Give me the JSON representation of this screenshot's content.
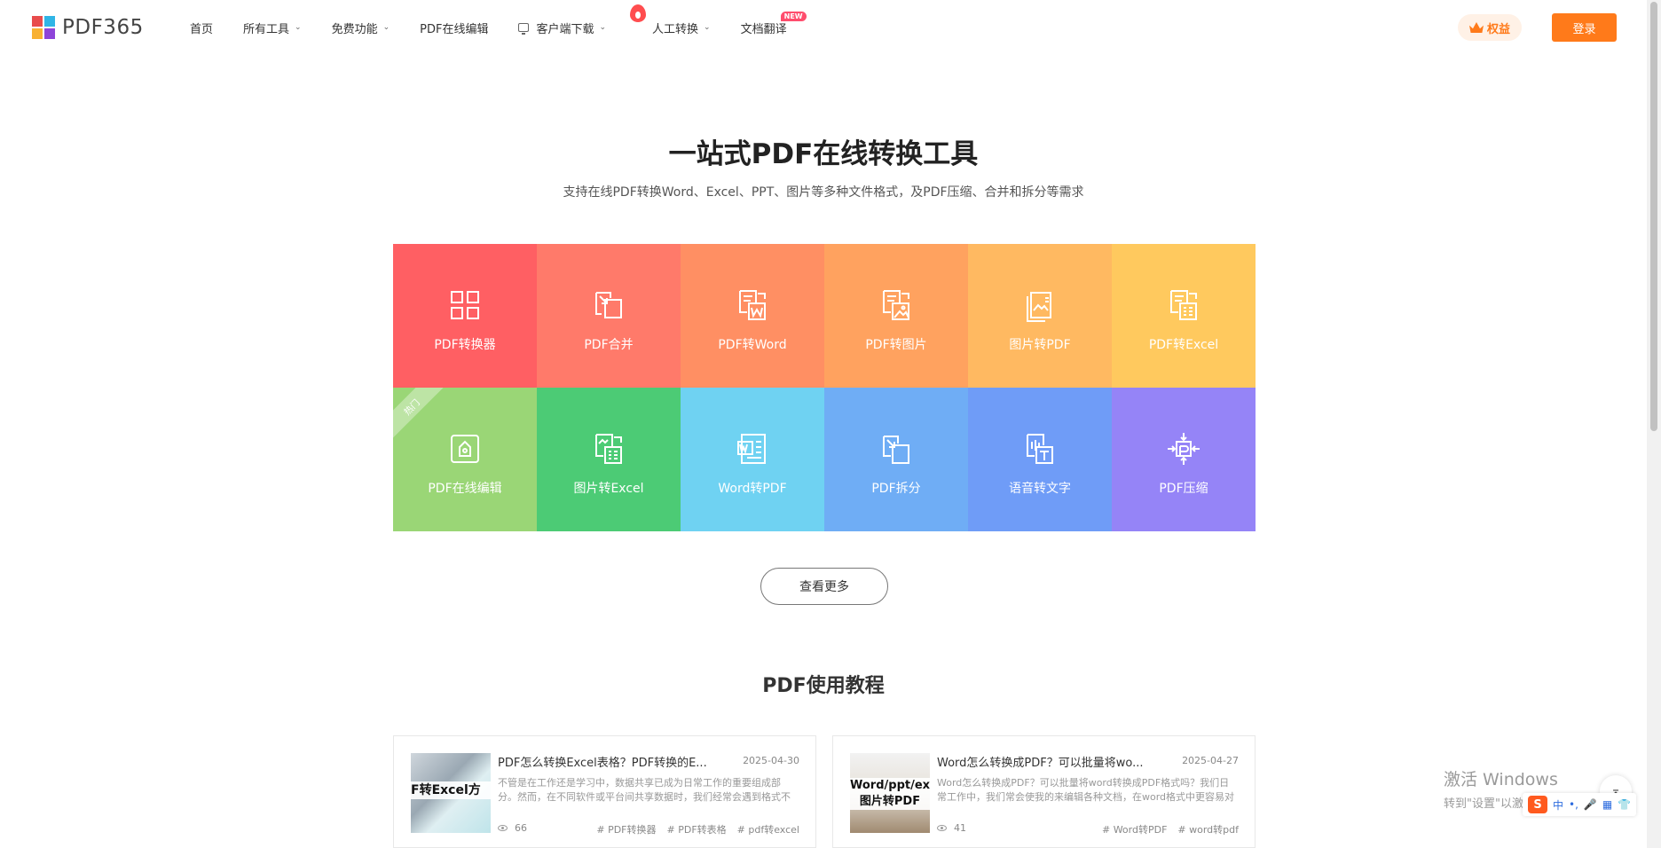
{
  "header": {
    "logo_text": "PDF365",
    "logo_colors": [
      "#e84c4c",
      "#2fb5e6",
      "#f8b133",
      "#8e44d9"
    ],
    "nav": [
      {
        "label": "首页",
        "caret": false
      },
      {
        "label": "所有工具",
        "caret": true
      },
      {
        "label": "免费功能",
        "caret": true
      },
      {
        "label": "PDF在线编辑",
        "caret": false
      },
      {
        "label": "客户端下载",
        "caret": true
      },
      {
        "label": "人工转换",
        "caret": true
      },
      {
        "label": "文档翻译",
        "caret": false
      }
    ],
    "new_badge": "NEW",
    "vip_label": "权益",
    "login_label": "登录"
  },
  "hero": {
    "title": "一站式PDF在线转换工具",
    "subtitle": "支持在线PDF转换Word、Excel、PPT、图片等多种文件格式，及PDF压缩、合并和拆分等需求"
  },
  "tools": [
    {
      "label": "PDF转换器",
      "color": "#ff5f63",
      "icon": "grid-icon"
    },
    {
      "label": "PDF合并",
      "color": "#ff7a6a",
      "icon": "merge-icon"
    },
    {
      "label": "PDF转Word",
      "color": "#ff8f63",
      "icon": "pdf-to-word-icon"
    },
    {
      "label": "PDF转图片",
      "color": "#ffa25f",
      "icon": "pdf-to-image-icon"
    },
    {
      "label": "图片转PDF",
      "color": "#ffb961",
      "icon": "image-to-pdf-icon"
    },
    {
      "label": "PDF转Excel",
      "color": "#ffc95e",
      "icon": "pdf-to-excel-icon"
    },
    {
      "label": "PDF在线编辑",
      "color": "#9ad676",
      "icon": "edit-icon",
      "ribbon": "热门"
    },
    {
      "label": "图片转Excel",
      "color": "#4ccb75",
      "icon": "image-to-excel-icon"
    },
    {
      "label": "Word转PDF",
      "color": "#6fd2f2",
      "icon": "word-to-pdf-icon"
    },
    {
      "label": "PDF拆分",
      "color": "#6fadf5",
      "icon": "split-icon"
    },
    {
      "label": "语音转文字",
      "color": "#6f9cf7",
      "icon": "voice-to-text-icon"
    },
    {
      "label": "PDF压缩",
      "color": "#9584f7",
      "icon": "compress-icon"
    }
  ],
  "more_label": "查看更多",
  "tutorial_title": "PDF使用教程",
  "articles": [
    {
      "thumb_text": "F转Excel方",
      "title": "PDF怎么转换Excel表格？PDF转换的E...",
      "date": "2025-04-30",
      "desc": "不管是在工作还是学习中，数据共享已成为日常工作的重要组成部分。然而，在不同软件或平台间共享数据时，我们经常会遇到格式不兼容...",
      "views": "66",
      "tags": [
        "# PDF转换器",
        "# PDF转表格",
        "# pdf转excel"
      ]
    },
    {
      "thumb_text": "Word/ppt/ex 图片转PDF",
      "title": "Word怎么转换成PDF？可以批量将wo...",
      "date": "2025-04-27",
      "desc": "Word怎么转换成PDF？可以批量将word转换成PDF格式吗？我们日常工作中，我们常会使我的来编辑各种文档，在word格式中更容易对文...",
      "views": "41",
      "tags": [
        "# Word转PDF",
        "# word转pdf"
      ]
    }
  ],
  "windows": {
    "line1": "激活 Windows",
    "line2": "转到\"设置\"以激活 Windows。"
  },
  "ime": {
    "logo": "S",
    "items": [
      "中",
      "•,",
      "🎤",
      "▦",
      "👕"
    ]
  },
  "back_top_label": "⌅"
}
